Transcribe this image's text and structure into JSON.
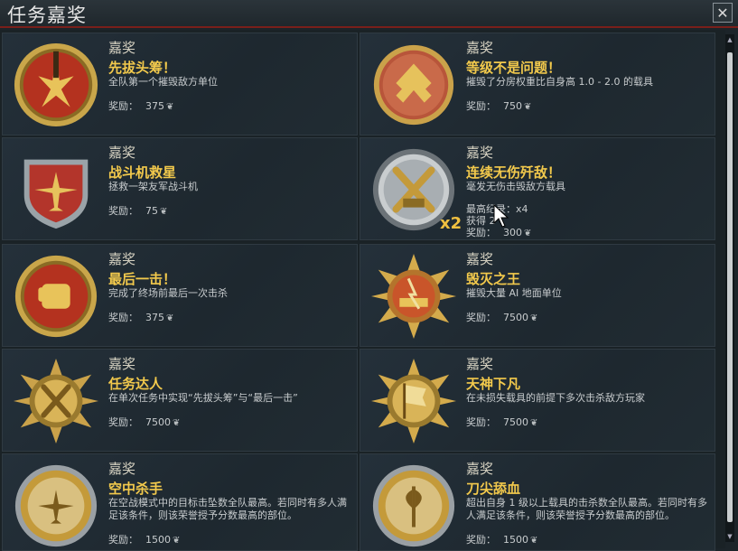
{
  "window": {
    "title": "任务嘉奖",
    "close_glyph": "✕"
  },
  "colors": {
    "accent": "#f2c94c",
    "title_underline": "#7a1f1a",
    "background": "#1a2226"
  },
  "cards": [
    {
      "category": "嘉奖",
      "name": "先拔头筹！",
      "desc": "全队第一个摧毁敌方单位",
      "reward_label": "奖励：",
      "reward": "375",
      "icon": "first-strike-medal-icon"
    },
    {
      "category": "嘉奖",
      "name": "等级不是问题！",
      "desc": "摧毁了分房权重比自身高 1.0 - 2.0 的载具",
      "reward_label": "奖励：",
      "reward": "750",
      "icon": "rank-chevron-medal-icon"
    },
    {
      "category": "嘉奖",
      "name": "战斗机救星",
      "desc": "拯救一架友军战斗机",
      "reward_label": "奖励：",
      "reward": "75",
      "icon": "fighter-shield-icon"
    },
    {
      "category": "嘉奖",
      "name": "连续无伤歼敌！",
      "desc": "毫发无伤击毁敌方载具",
      "record_label": "最高纪录：",
      "record": "x4",
      "obtained_label": "获得 2",
      "reward_label": "奖励：",
      "reward": "300",
      "multiplier": "x2",
      "icon": "crossed-swords-medal-icon"
    },
    {
      "category": "嘉奖",
      "name": "最后一击！",
      "desc": "完成了终场前最后一次击杀",
      "reward_label": "奖励：",
      "reward": "375",
      "icon": "fist-medal-icon"
    },
    {
      "category": "嘉奖",
      "name": "毁灭之王",
      "desc": "摧毁大量 AI 地面单位",
      "reward_label": "奖励：",
      "reward": "7500",
      "icon": "destroyer-star-medal-icon"
    },
    {
      "category": "嘉奖",
      "name": "任务达人",
      "desc": "在单次任务中实现“先拔头筹”与“最后一击”",
      "reward_label": "奖励：",
      "reward": "7500",
      "icon": "tools-star-medal-icon"
    },
    {
      "category": "嘉奖",
      "name": "天神下凡",
      "desc": "在未损失载具的前提下多次击杀敌方玩家",
      "reward_label": "奖励：",
      "reward": "7500",
      "icon": "flag-star-medal-icon"
    },
    {
      "category": "嘉奖",
      "name": "空中杀手",
      "desc": "在空战模式中的目标击坠数全队最高。若同时有多人满足该条件，则该荣誉授予分数最高的部位。",
      "reward_label": "奖励：",
      "reward": "1500",
      "icon": "plane-wreath-medal-icon"
    },
    {
      "category": "嘉奖",
      "name": "刀尖舔血",
      "desc": "超出自身 1 级以上载具的击杀数全队最高。若同时有多人满足该条件，则该荣誉授予分数最高的部位。",
      "reward_label": "奖励：",
      "reward": "1500",
      "icon": "axe-wreath-medal-icon"
    }
  ]
}
